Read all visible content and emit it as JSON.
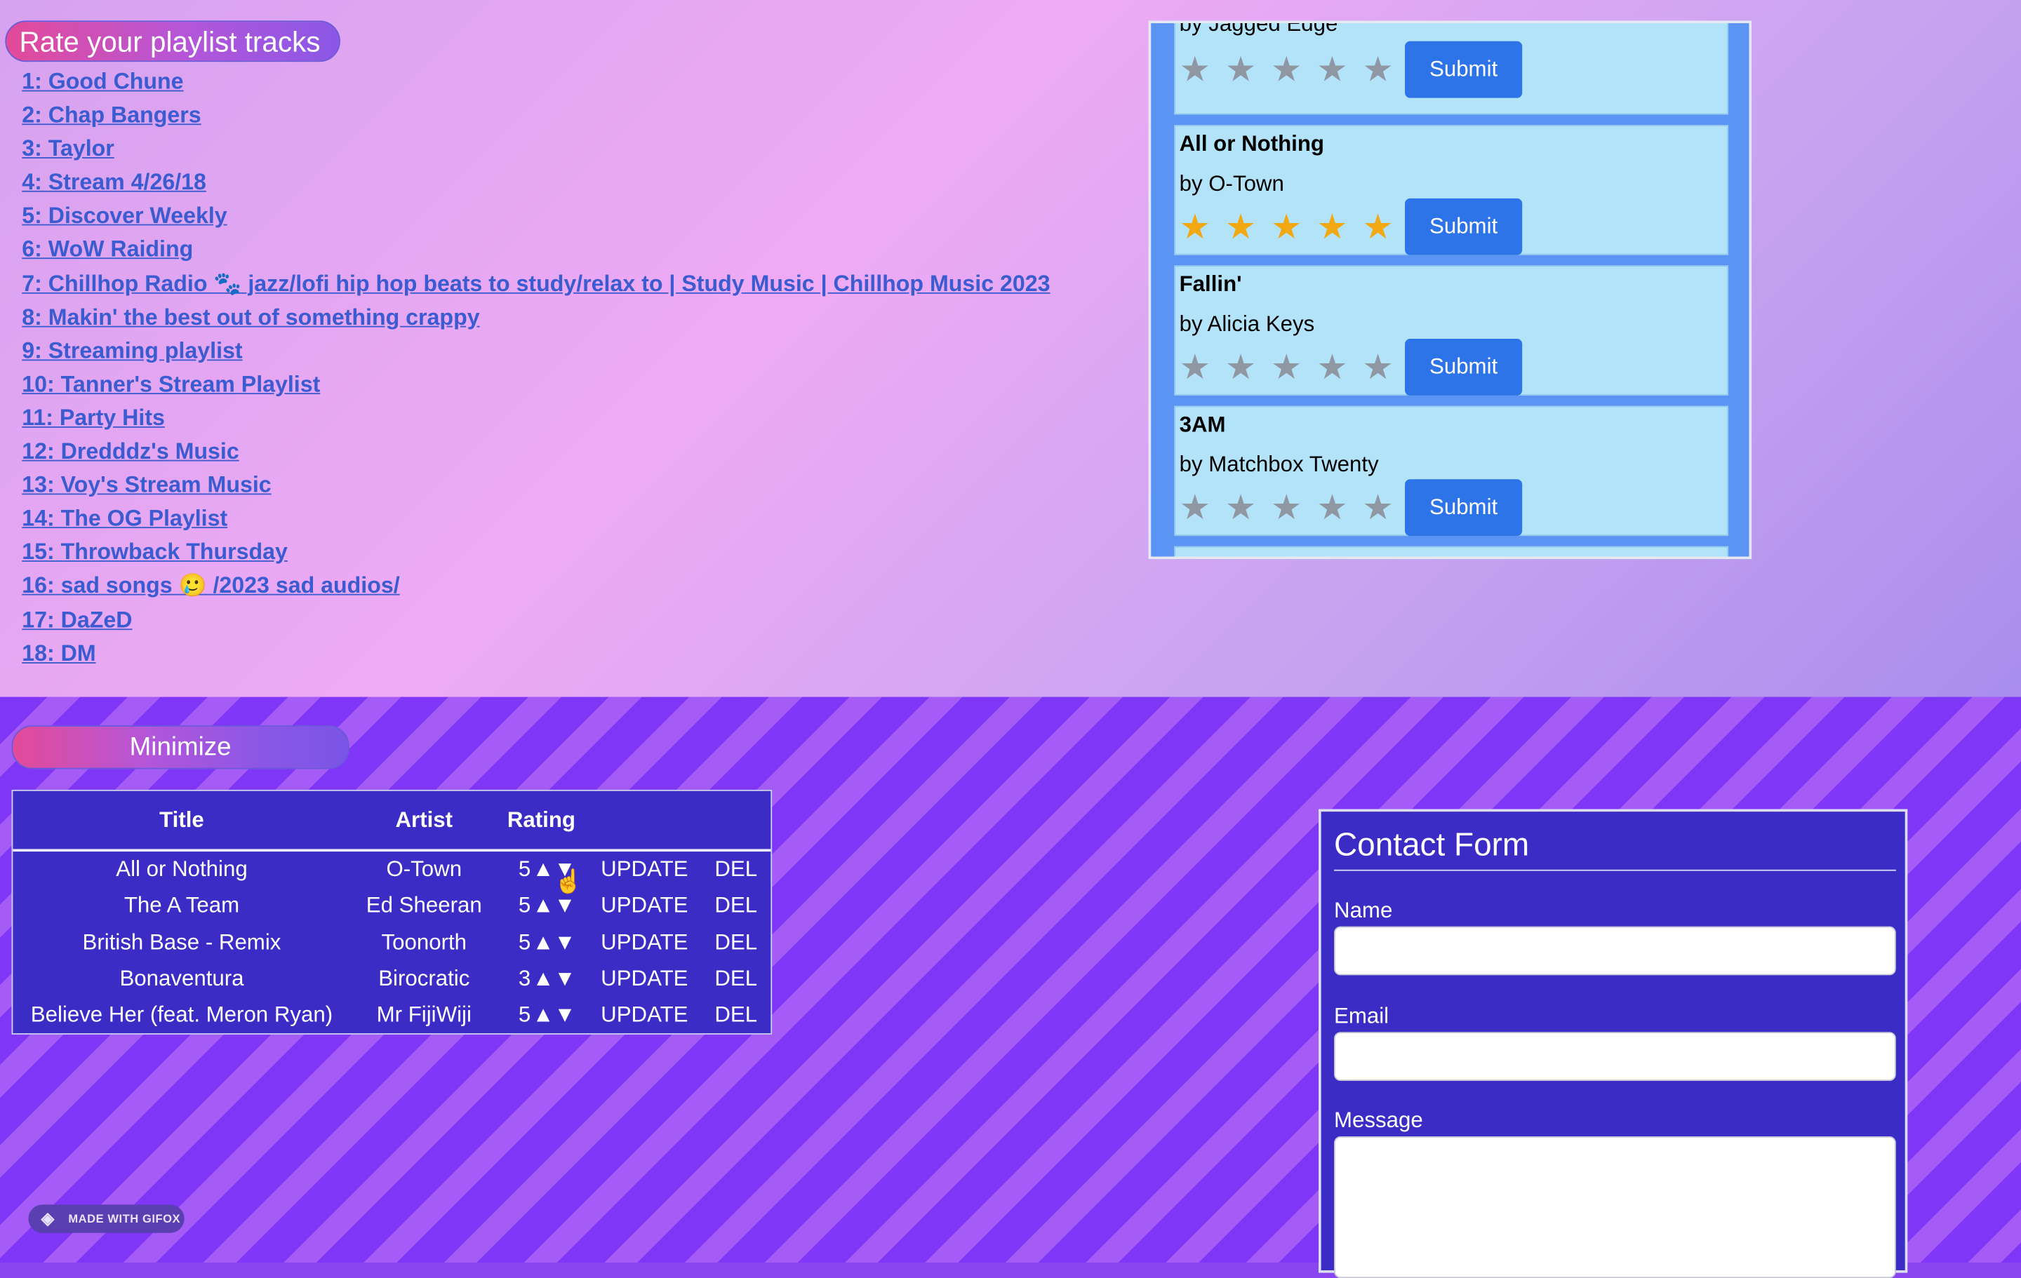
{
  "header": {
    "rate_title": "Rate your playlist tracks"
  },
  "playlists": [
    "1: Good Chune",
    "2: Chap Bangers",
    "3: Taylor",
    "4: Stream 4/26/18",
    "5: Discover Weekly",
    "6: WoW Raiding",
    "7: Chillhop Radio 🐾 jazz/lofi hip hop beats to study/relax to | Study Music | Chillhop Music 2023",
    "8: Makin' the best out of something crappy",
    "9: Streaming playlist",
    "10: Tanner's Stream Playlist",
    "11: Party Hits",
    "12: Dredddz's Music",
    "13: Voy's Stream Music",
    "14: The OG Playlist",
    "15: Throwback Thursday",
    "16: sad songs 🥲 /2023 sad audios/",
    "17: DaZeD",
    "18: DM"
  ],
  "tracks": [
    {
      "title": "",
      "artist": "by Jagged Edge",
      "rating": 0,
      "submit": "Submit"
    },
    {
      "title": "All or Nothing",
      "artist": "by O-Town",
      "rating": 5,
      "submit": "Submit"
    },
    {
      "title": "Fallin'",
      "artist": "by Alicia Keys",
      "rating": 0,
      "submit": "Submit"
    },
    {
      "title": "3AM",
      "artist": "by Matchbox Twenty",
      "rating": 0,
      "submit": "Submit"
    }
  ],
  "star_glyph": "★",
  "minimize_label": "Minimize",
  "ratings_table": {
    "headers": {
      "title": "Title",
      "artist": "Artist",
      "rating": "Rating"
    },
    "update_label": "UPDATE",
    "delete_label": "DEL",
    "arrows": "▲▼",
    "rows": [
      {
        "title": "All or Nothing",
        "artist": "O-Town",
        "rating": "5"
      },
      {
        "title": "The A Team",
        "artist": "Ed Sheeran",
        "rating": "5"
      },
      {
        "title": "British Base - Remix",
        "artist": "Toonorth",
        "rating": "5"
      },
      {
        "title": "Bonaventura",
        "artist": "Birocratic",
        "rating": "3"
      },
      {
        "title": "Believe Her (feat. Meron Ryan)",
        "artist": "Mr FijiWiji",
        "rating": "5"
      }
    ]
  },
  "contact": {
    "title": "Contact Form",
    "name_label": "Name",
    "email_label": "Email",
    "message_label": "Message",
    "name_value": "",
    "email_value": "",
    "message_value": ""
  },
  "badge": {
    "text": "MADE WITH GIFOX",
    "icon": "fox-icon"
  },
  "colors": {
    "star_on": "#f2a812",
    "star_off": "#8f97a3",
    "submit_bg": "#2d74e8",
    "table_bg": "#3a2cc4",
    "link": "#3b5bd0"
  }
}
